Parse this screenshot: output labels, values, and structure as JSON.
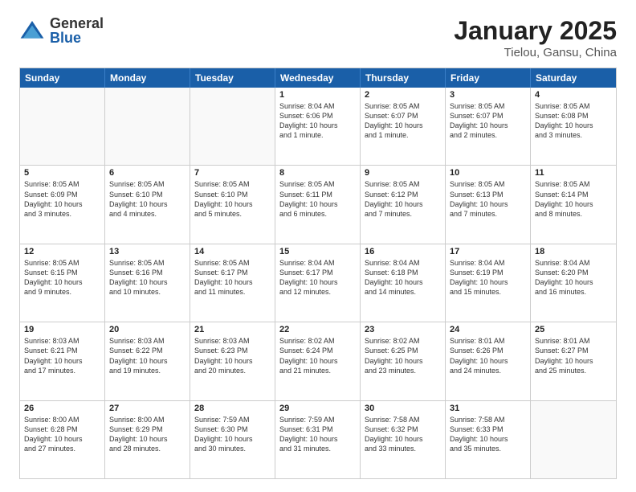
{
  "logo": {
    "general": "General",
    "blue": "Blue"
  },
  "title": "January 2025",
  "subtitle": "Tielou, Gansu, China",
  "days_of_week": [
    "Sunday",
    "Monday",
    "Tuesday",
    "Wednesday",
    "Thursday",
    "Friday",
    "Saturday"
  ],
  "weeks": [
    [
      {
        "num": "",
        "info": ""
      },
      {
        "num": "",
        "info": ""
      },
      {
        "num": "",
        "info": ""
      },
      {
        "num": "1",
        "info": "Sunrise: 8:04 AM\nSunset: 6:06 PM\nDaylight: 10 hours\nand 1 minute."
      },
      {
        "num": "2",
        "info": "Sunrise: 8:05 AM\nSunset: 6:07 PM\nDaylight: 10 hours\nand 1 minute."
      },
      {
        "num": "3",
        "info": "Sunrise: 8:05 AM\nSunset: 6:07 PM\nDaylight: 10 hours\nand 2 minutes."
      },
      {
        "num": "4",
        "info": "Sunrise: 8:05 AM\nSunset: 6:08 PM\nDaylight: 10 hours\nand 3 minutes."
      }
    ],
    [
      {
        "num": "5",
        "info": "Sunrise: 8:05 AM\nSunset: 6:09 PM\nDaylight: 10 hours\nand 3 minutes."
      },
      {
        "num": "6",
        "info": "Sunrise: 8:05 AM\nSunset: 6:10 PM\nDaylight: 10 hours\nand 4 minutes."
      },
      {
        "num": "7",
        "info": "Sunrise: 8:05 AM\nSunset: 6:10 PM\nDaylight: 10 hours\nand 5 minutes."
      },
      {
        "num": "8",
        "info": "Sunrise: 8:05 AM\nSunset: 6:11 PM\nDaylight: 10 hours\nand 6 minutes."
      },
      {
        "num": "9",
        "info": "Sunrise: 8:05 AM\nSunset: 6:12 PM\nDaylight: 10 hours\nand 7 minutes."
      },
      {
        "num": "10",
        "info": "Sunrise: 8:05 AM\nSunset: 6:13 PM\nDaylight: 10 hours\nand 7 minutes."
      },
      {
        "num": "11",
        "info": "Sunrise: 8:05 AM\nSunset: 6:14 PM\nDaylight: 10 hours\nand 8 minutes."
      }
    ],
    [
      {
        "num": "12",
        "info": "Sunrise: 8:05 AM\nSunset: 6:15 PM\nDaylight: 10 hours\nand 9 minutes."
      },
      {
        "num": "13",
        "info": "Sunrise: 8:05 AM\nSunset: 6:16 PM\nDaylight: 10 hours\nand 10 minutes."
      },
      {
        "num": "14",
        "info": "Sunrise: 8:05 AM\nSunset: 6:17 PM\nDaylight: 10 hours\nand 11 minutes."
      },
      {
        "num": "15",
        "info": "Sunrise: 8:04 AM\nSunset: 6:17 PM\nDaylight: 10 hours\nand 12 minutes."
      },
      {
        "num": "16",
        "info": "Sunrise: 8:04 AM\nSunset: 6:18 PM\nDaylight: 10 hours\nand 14 minutes."
      },
      {
        "num": "17",
        "info": "Sunrise: 8:04 AM\nSunset: 6:19 PM\nDaylight: 10 hours\nand 15 minutes."
      },
      {
        "num": "18",
        "info": "Sunrise: 8:04 AM\nSunset: 6:20 PM\nDaylight: 10 hours\nand 16 minutes."
      }
    ],
    [
      {
        "num": "19",
        "info": "Sunrise: 8:03 AM\nSunset: 6:21 PM\nDaylight: 10 hours\nand 17 minutes."
      },
      {
        "num": "20",
        "info": "Sunrise: 8:03 AM\nSunset: 6:22 PM\nDaylight: 10 hours\nand 19 minutes."
      },
      {
        "num": "21",
        "info": "Sunrise: 8:03 AM\nSunset: 6:23 PM\nDaylight: 10 hours\nand 20 minutes."
      },
      {
        "num": "22",
        "info": "Sunrise: 8:02 AM\nSunset: 6:24 PM\nDaylight: 10 hours\nand 21 minutes."
      },
      {
        "num": "23",
        "info": "Sunrise: 8:02 AM\nSunset: 6:25 PM\nDaylight: 10 hours\nand 23 minutes."
      },
      {
        "num": "24",
        "info": "Sunrise: 8:01 AM\nSunset: 6:26 PM\nDaylight: 10 hours\nand 24 minutes."
      },
      {
        "num": "25",
        "info": "Sunrise: 8:01 AM\nSunset: 6:27 PM\nDaylight: 10 hours\nand 25 minutes."
      }
    ],
    [
      {
        "num": "26",
        "info": "Sunrise: 8:00 AM\nSunset: 6:28 PM\nDaylight: 10 hours\nand 27 minutes."
      },
      {
        "num": "27",
        "info": "Sunrise: 8:00 AM\nSunset: 6:29 PM\nDaylight: 10 hours\nand 28 minutes."
      },
      {
        "num": "28",
        "info": "Sunrise: 7:59 AM\nSunset: 6:30 PM\nDaylight: 10 hours\nand 30 minutes."
      },
      {
        "num": "29",
        "info": "Sunrise: 7:59 AM\nSunset: 6:31 PM\nDaylight: 10 hours\nand 31 minutes."
      },
      {
        "num": "30",
        "info": "Sunrise: 7:58 AM\nSunset: 6:32 PM\nDaylight: 10 hours\nand 33 minutes."
      },
      {
        "num": "31",
        "info": "Sunrise: 7:58 AM\nSunset: 6:33 PM\nDaylight: 10 hours\nand 35 minutes."
      },
      {
        "num": "",
        "info": ""
      }
    ]
  ]
}
